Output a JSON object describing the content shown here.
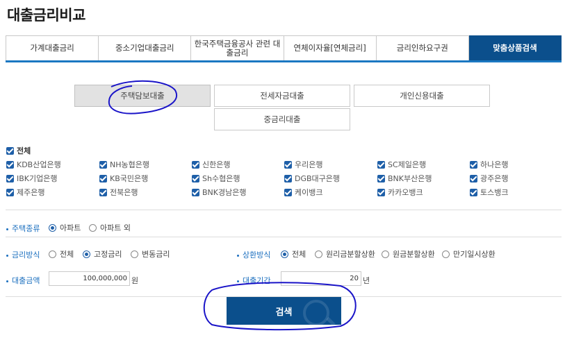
{
  "page_title": "대출금리비교",
  "tabs": [
    {
      "label": "가계대출금리",
      "active": false
    },
    {
      "label": "중소기업대출금리",
      "active": false
    },
    {
      "label": "한국주택금융공사 관련 대출금리",
      "active": false
    },
    {
      "label": "연체이자율[연체금리]",
      "active": false
    },
    {
      "label": "금리인하요구권",
      "active": false
    },
    {
      "label": "맞춤상품검색",
      "active": true
    }
  ],
  "product_types": [
    {
      "label": "주택담보대출",
      "selected": true
    },
    {
      "label": "전세자금대출",
      "selected": false
    },
    {
      "label": "개인신용대출",
      "selected": false
    },
    {
      "label": "중금리대출",
      "selected": false
    }
  ],
  "banks": {
    "all_label": "전체",
    "all_checked": true,
    "items": [
      {
        "label": "KDB산업은행",
        "checked": true
      },
      {
        "label": "NH농협은행",
        "checked": true
      },
      {
        "label": "신한은행",
        "checked": true
      },
      {
        "label": "우리은행",
        "checked": true
      },
      {
        "label": "SC제일은행",
        "checked": true
      },
      {
        "label": "하나은행",
        "checked": true
      },
      {
        "label": "IBK기업은행",
        "checked": true
      },
      {
        "label": "KB국민은행",
        "checked": true
      },
      {
        "label": "Sh수협은행",
        "checked": true
      },
      {
        "label": "DGB대구은행",
        "checked": true
      },
      {
        "label": "BNK부산은행",
        "checked": true
      },
      {
        "label": "광주은행",
        "checked": true
      },
      {
        "label": "제주은행",
        "checked": true
      },
      {
        "label": "전북은행",
        "checked": true
      },
      {
        "label": "BNK경남은행",
        "checked": true
      },
      {
        "label": "케이뱅크",
        "checked": true
      },
      {
        "label": "카카오뱅크",
        "checked": true
      },
      {
        "label": "토스뱅크",
        "checked": true
      }
    ]
  },
  "filters": {
    "housing_type": {
      "label": "주택종류",
      "options": [
        {
          "label": "아파트",
          "selected": true
        },
        {
          "label": "아파트 외",
          "selected": false
        }
      ]
    },
    "rate_type": {
      "label": "금리방식",
      "options": [
        {
          "label": "전체",
          "selected": false
        },
        {
          "label": "고정금리",
          "selected": true
        },
        {
          "label": "변동금리",
          "selected": false
        }
      ]
    },
    "repayment_type": {
      "label": "상환방식",
      "options": [
        {
          "label": "전체",
          "selected": true
        },
        {
          "label": "원리금분할상환",
          "selected": false
        },
        {
          "label": "원금분할상환",
          "selected": false
        },
        {
          "label": "만기일시상환",
          "selected": false
        }
      ]
    },
    "loan_amount": {
      "label": "대출금액",
      "value": "100,000,000",
      "unit": "원"
    },
    "loan_period": {
      "label": "대출기간",
      "value": "20",
      "unit": "년"
    }
  },
  "search_button": {
    "label": "검색"
  },
  "colors": {
    "accent": "#0b4f8c",
    "tab_underline": "#1b78c2",
    "checkbox": "#1e5fa8",
    "filter_label": "#1b6fbf",
    "annotation_ink": "#1a14c8"
  }
}
